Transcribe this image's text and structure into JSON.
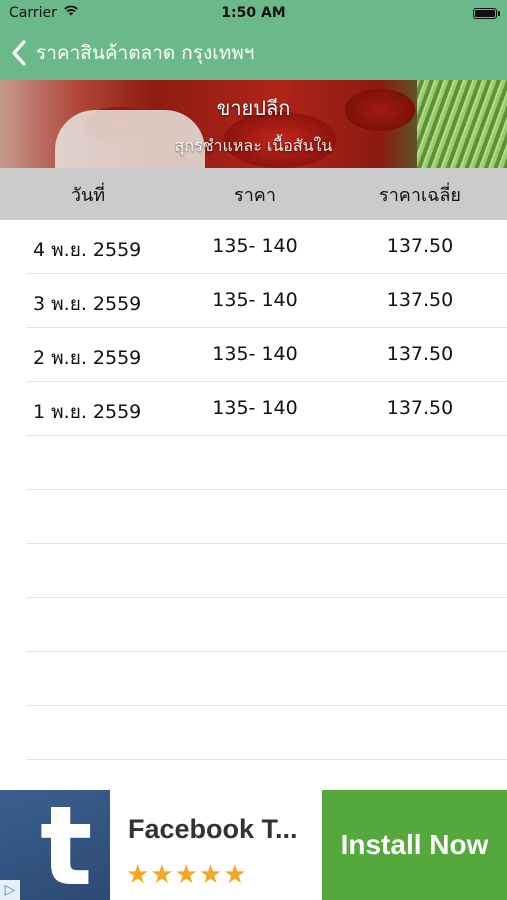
{
  "status_bar": {
    "carrier": "Carrier",
    "time": "1:50 AM"
  },
  "nav": {
    "back_title": "ราคาสินค้าตลาด กรุงเทพฯ"
  },
  "banner": {
    "title": "ขายปลีก",
    "subtitle": "สุกรชำแหละ เนื้อสันใน"
  },
  "table": {
    "headers": [
      "วันที่",
      "ราคา",
      "ราคาเฉลี่ย"
    ],
    "rows": [
      {
        "date": "4 พ.ย. 2559",
        "price": "135- 140",
        "average": "137.50"
      },
      {
        "date": "3 พ.ย. 2559",
        "price": "135- 140",
        "average": "137.50"
      },
      {
        "date": "2 พ.ย. 2559",
        "price": "135- 140",
        "average": "137.50"
      },
      {
        "date": "1 พ.ย. 2559",
        "price": "135- 140",
        "average": "137.50"
      }
    ]
  },
  "ad": {
    "logo_letter": "t",
    "app_name": "Facebook T...",
    "stars": "★★★★★",
    "install_label": "Install Now",
    "adchoices_glyph": "▷"
  },
  "colors": {
    "nav": "#6bb98a",
    "header": "#cbcbcb",
    "install": "#55a93c",
    "stars": "#f5a623"
  }
}
